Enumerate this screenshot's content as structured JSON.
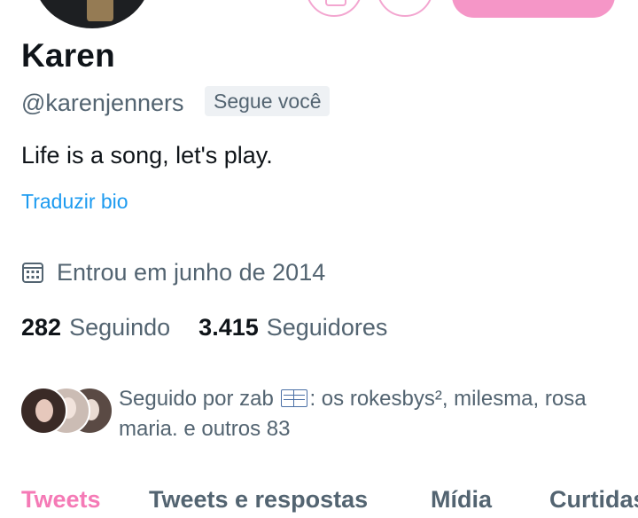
{
  "profile": {
    "name": "Karen",
    "handle": "@karenjenners",
    "follows_you_badge": "Segue você",
    "bio": "Life is a song, let's play.",
    "translate_bio": "Traduzir bio",
    "joined": "Entrou em junho de 2014"
  },
  "stats": {
    "following_count": "282",
    "following_label": "Seguindo",
    "followers_count": "3.415",
    "followers_label": "Seguidores"
  },
  "followed_by": {
    "prefix": "Seguido por zab ",
    "suffix": ": os rokesbys², milesma, rosa maria. e outros 83"
  },
  "tabs": [
    {
      "label": "Tweets",
      "active": true
    },
    {
      "label": "Tweets e respostas",
      "active": false
    },
    {
      "label": "Mídia",
      "active": false
    },
    {
      "label": "Curtidas",
      "active": false
    }
  ],
  "icons": {
    "joined": "calendar-icon",
    "book": "open-book-emoji"
  },
  "colors": {
    "accent": "#f596c7",
    "active_tab": "#f57ab6",
    "link": "#1d9bf0",
    "secondary_text": "#536471"
  }
}
